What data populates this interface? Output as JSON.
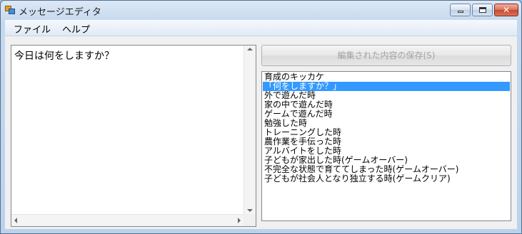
{
  "window": {
    "title": "メッセージエディタ",
    "close_glyph": "✕"
  },
  "menu": {
    "file": "ファイル",
    "help": "ヘルプ"
  },
  "editor": {
    "text": "今日は何をしますか？"
  },
  "save_button": {
    "label": "編集された内容の保存(S)",
    "enabled": false
  },
  "list": {
    "selected_index": 1,
    "items": [
      "育成のキッカケ",
      "「何をしますか？」",
      "外で遊んだ時",
      "家の中で遊んだ時",
      "ゲームで遊んだ時",
      "勉強した時",
      "トレーニングした時",
      "農作業を手伝った時",
      "アルバイトをした時",
      "子どもが家出した時(ゲームオーバー)",
      "不完全な状態で育ててしまった時(ゲームオーバー)",
      "子どもが社会人となり独立する時(ゲームクリア)"
    ]
  },
  "colors": {
    "selection": "#3399ff",
    "disabled_text": "#a2a2a2"
  }
}
